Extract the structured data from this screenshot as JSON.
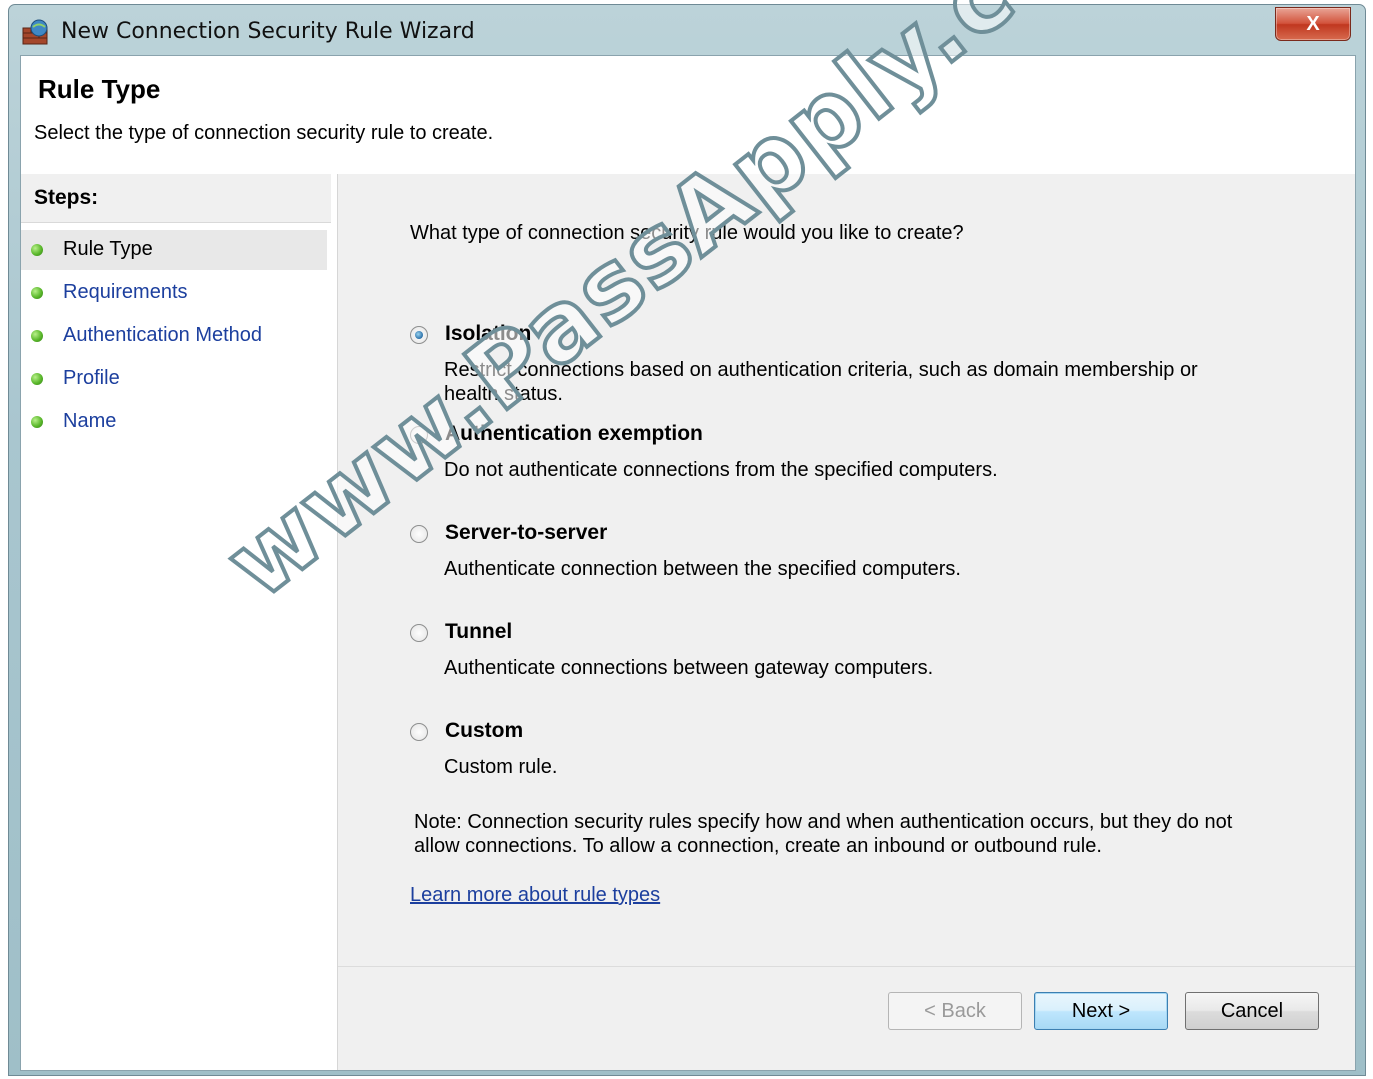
{
  "window": {
    "title": "New Connection Security Rule Wizard",
    "close_label": "X"
  },
  "header": {
    "title": "Rule Type",
    "subtitle": "Select the type of connection security rule to create."
  },
  "steps": {
    "heading": "Steps:",
    "items": [
      {
        "label": "Rule Type",
        "active": true
      },
      {
        "label": "Requirements",
        "active": false
      },
      {
        "label": "Authentication Method",
        "active": false
      },
      {
        "label": "Profile",
        "active": false
      },
      {
        "label": "Name",
        "active": false
      }
    ]
  },
  "main": {
    "question": "What type of connection security rule would you like to create?",
    "options": [
      {
        "label": "Isolation",
        "description": "Restrict connections based on authentication criteria, such as domain membership or health status.",
        "selected": true
      },
      {
        "label": "Authentication exemption",
        "description": "Do not authenticate connections from the specified computers.",
        "selected": false
      },
      {
        "label": "Server-to-server",
        "description": "Authenticate connection between the specified computers.",
        "selected": false
      },
      {
        "label": "Tunnel",
        "description": "Authenticate connections between gateway computers.",
        "selected": false
      },
      {
        "label": "Custom",
        "description": "Custom rule.",
        "selected": false
      }
    ],
    "note": "Note:  Connection security rules specify how and when authentication occurs, but they do not allow connections.  To allow a connection, create an inbound or outbound rule.",
    "learn_more": "Learn more about rule types"
  },
  "buttons": {
    "back": "< Back",
    "next": "Next >",
    "cancel": "Cancel"
  },
  "watermark": "www.PassApply.com"
}
